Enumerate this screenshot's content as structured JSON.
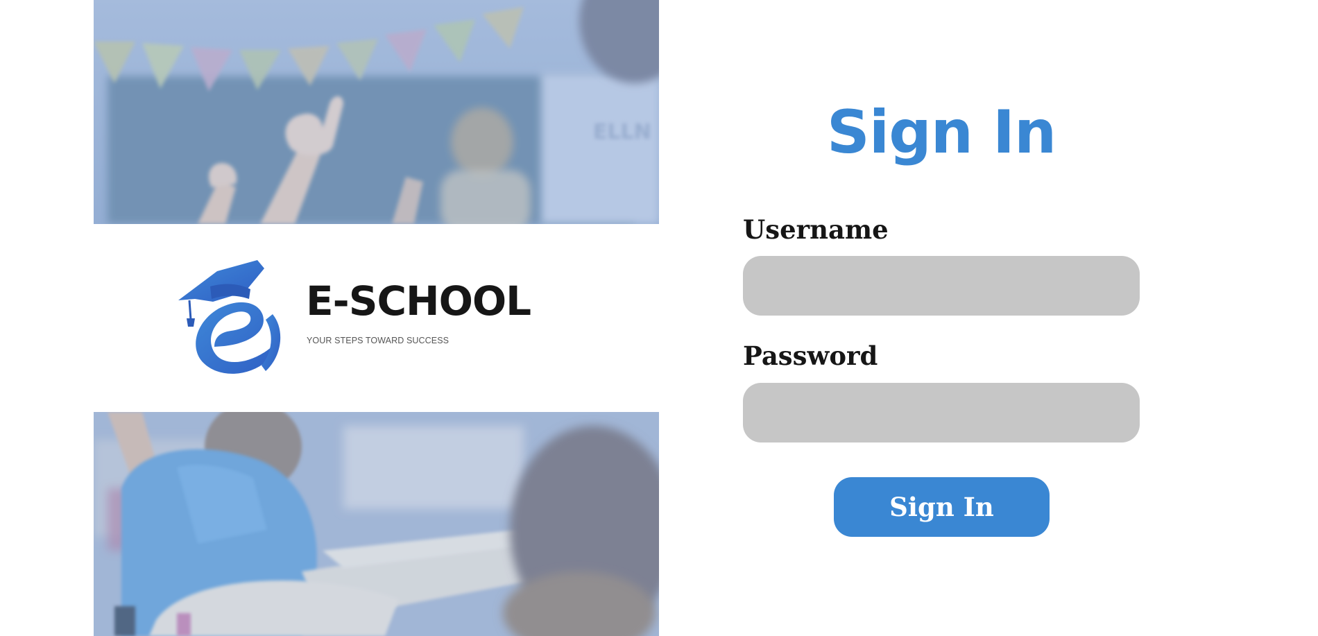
{
  "brand": {
    "name": "E-SCHOOL",
    "tagline": "YOUR STEPS TOWARD SUCCESS",
    "logo_icon": "graduation-cap-e-icon",
    "logo_color": "#3a7bd5"
  },
  "hero_images": {
    "top": "classroom-raised-hands-photo",
    "bottom": "student-blue-shirt-raising-hand-photo",
    "overlay_color": "#9db6dc"
  },
  "form": {
    "title": "Sign In",
    "username": {
      "label": "Username",
      "value": "",
      "placeholder": ""
    },
    "password": {
      "label": "Password",
      "value": "",
      "placeholder": ""
    },
    "submit_label": "Sign In"
  },
  "colors": {
    "accent": "#3a87d3",
    "input_background": "#c6c6c6",
    "text": "#161616"
  }
}
